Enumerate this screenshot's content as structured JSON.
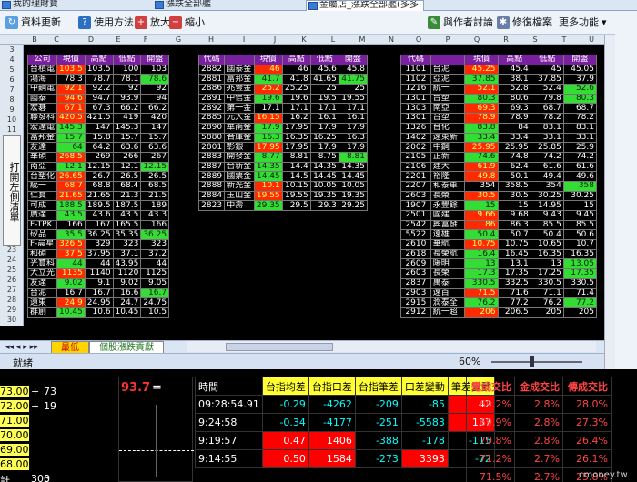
{
  "tabs": [
    "我的理財寶",
    "漲跌全部艦",
    "金屬店_漲跌全部艦(多多"
  ],
  "toolbar": {
    "update": "資料更新",
    "help": "使用方法",
    "zoom_in": "放大",
    "zoom_out": "縮小",
    "author": "與作者討論",
    "repair": "修復檔案",
    "more": "更多功能"
  },
  "col_letters": [
    "B",
    "C",
    "D",
    "E",
    "F",
    "G",
    "H",
    "I",
    "J",
    "K",
    "L",
    "M",
    "N",
    "O",
    "P",
    "Q",
    "R",
    "S",
    "T",
    "U"
  ],
  "row_nums": [
    "3",
    "4",
    "5",
    "6",
    "7",
    "8",
    "9",
    "10",
    "11",
    "12",
    "13",
    "14",
    "15",
    "16",
    "17",
    "18",
    "19",
    "20",
    "21",
    "22",
    "23",
    "24",
    "25",
    "26",
    "27",
    "28",
    "29",
    "30"
  ],
  "side_button": "打開左側清單",
  "headers": [
    "公司",
    "現價",
    "高點",
    "低點",
    "開盤"
  ],
  "headers2": [
    "代碼",
    "現價",
    "高點",
    "低點",
    "開盤"
  ],
  "table1": [
    [
      "台積電",
      "103.5",
      "103.5",
      "100",
      "103",
      "up",
      ""
    ],
    [
      "鴻海",
      "78.3",
      "78.7",
      "78.1",
      "78.6",
      "",
      "dn"
    ],
    [
      "中鋼電",
      "92.1",
      "92.2",
      "92",
      "92",
      "up",
      ""
    ],
    [
      "國泰",
      "94.6",
      "94.7",
      "93.9",
      "94",
      "up",
      ""
    ],
    [
      "宏碁",
      "67.1",
      "67.3",
      "66.2",
      "66.2",
      "up",
      ""
    ],
    [
      "聯發科",
      "420.5",
      "421.5",
      "419",
      "420",
      "up",
      ""
    ],
    [
      "宏達電",
      "145.3",
      "147",
      "145.3",
      "147",
      "dn",
      ""
    ],
    [
      "富邦金",
      "15.7",
      "15.8",
      "15.7",
      "15.7",
      "dn",
      ""
    ],
    [
      "友達",
      "64",
      "64.2",
      "63.6",
      "63.6",
      "dn",
      ""
    ],
    [
      "華碩",
      "268.5",
      "269",
      "266",
      "267",
      "up",
      ""
    ],
    [
      "南亞",
      "12.1",
      "12.15",
      "12.1",
      "12.15",
      "dn",
      "dn"
    ],
    [
      "台塑化",
      "26.65",
      "26.7",
      "26.5",
      "26.5",
      "up",
      ""
    ],
    [
      "統一",
      "68.7",
      "68.8",
      "68.4",
      "68.5",
      "up",
      ""
    ],
    [
      "仁寶",
      "21.65",
      "21.65",
      "21.3",
      "21.5",
      "up",
      ""
    ],
    [
      "可成",
      "188.5",
      "189.5",
      "187.5",
      "189",
      "dn",
      ""
    ],
    [
      "廣達",
      "43.5",
      "43.6",
      "43.5",
      "43.3",
      "dn",
      ""
    ],
    [
      "F-TPK",
      "166",
      "167",
      "165.5",
      "166",
      "",
      ""
    ],
    [
      "矽品",
      "35.5",
      "36.25",
      "35.35",
      "36.25",
      "dn",
      "dn"
    ],
    [
      "F-晨星",
      "326.5",
      "329",
      "323",
      "323",
      "up",
      ""
    ],
    [
      "和碩",
      "37.5",
      "37.95",
      "37.1",
      "37.2",
      "up",
      ""
    ],
    [
      "光寶科",
      "44",
      "44",
      "43.95",
      "44",
      "dn",
      ""
    ],
    [
      "大立光",
      "1135",
      "1140",
      "1120",
      "1125",
      "up",
      ""
    ],
    [
      "友達",
      "9.02",
      "9.1",
      "9.02",
      "9.05",
      "dn",
      ""
    ],
    [
      "台泥",
      "16.7",
      "16.7",
      "16.6",
      "16.7",
      "",
      "dn"
    ],
    [
      "遠東",
      "24.9",
      "24.95",
      "24.7",
      "24.75",
      "up",
      ""
    ],
    [
      "群創",
      "10.45",
      "10.6",
      "10.45",
      "10.5",
      "dn",
      ""
    ]
  ],
  "table2": [
    [
      "2882",
      "國泰金",
      "46",
      "46",
      "45.6",
      "45.8",
      "up",
      ""
    ],
    [
      "2881",
      "富邦金",
      "41.7",
      "41.8",
      "41.65",
      "41.75",
      "dn",
      "dn"
    ],
    [
      "2886",
      "兆豐金",
      "25.2",
      "25.25",
      "25",
      "25",
      "up",
      ""
    ],
    [
      "2891",
      "中信金",
      "19.6",
      "19.6",
      "19.5",
      "19.55",
      "dn",
      ""
    ],
    [
      "2892",
      "第一金",
      "17.1",
      "17.1",
      "17.1",
      "17.1",
      "",
      ""
    ],
    [
      "2885",
      "元大金",
      "16.15",
      "16.2",
      "16.1",
      "16.1",
      "up",
      ""
    ],
    [
      "2890",
      "華南金",
      "17.9",
      "17.95",
      "17.9",
      "17.9",
      "dn",
      ""
    ],
    [
      "5880",
      "合庫金",
      "16.3",
      "16.35",
      "16.25",
      "16.3",
      "dn",
      ""
    ],
    [
      "2801",
      "彰銀",
      "17.95",
      "17.95",
      "17.9",
      "17.9",
      "up",
      ""
    ],
    [
      "2883",
      "開發金",
      "8.77",
      "8.81",
      "8.75",
      "8.81",
      "dn",
      "dn"
    ],
    [
      "2887",
      "台新金",
      "14.35",
      "14.4",
      "14.35",
      "14.35",
      "dn",
      ""
    ],
    [
      "2889",
      "國票金",
      "14.45",
      "14.5",
      "14.45",
      "14.45",
      "dn",
      ""
    ],
    [
      "2888",
      "新光金",
      "10.1",
      "10.15",
      "10.05",
      "10.05",
      "up",
      ""
    ],
    [
      "2884",
      "玉山金",
      "19.55",
      "19.55",
      "19.35",
      "19.35",
      "up",
      ""
    ],
    [
      "2823",
      "中壽",
      "29.35",
      "29.5",
      "29.3",
      "29.25",
      "dn",
      ""
    ]
  ],
  "table3": [
    [
      "1101",
      "台泥",
      "45.25",
      "45.4",
      "45",
      "45.05",
      "up",
      ""
    ],
    [
      "1102",
      "亞泥",
      "37.85",
      "38.1",
      "37.85",
      "37.9",
      "dn",
      ""
    ],
    [
      "1216",
      "統一",
      "52.1",
      "52.8",
      "52.4",
      "52.6",
      "up",
      "dn"
    ],
    [
      "1301",
      "台塑",
      "80.3",
      "80.6",
      "79.8",
      "80.3",
      "dn",
      "dn"
    ],
    [
      "1303",
      "南亞",
      "69.3",
      "69.3",
      "68.7",
      "68.7",
      "up",
      ""
    ],
    [
      "1301",
      "台塑",
      "78.9",
      "78.9",
      "78.2",
      "78.2",
      "up",
      ""
    ],
    [
      "1326",
      "台化",
      "83.8",
      "84",
      "83.1",
      "83.1",
      "dn",
      ""
    ],
    [
      "1402",
      "遠東新",
      "33.4",
      "33.4",
      "33.1",
      "33.1",
      "dn",
      ""
    ],
    [
      "2002",
      "中鋼",
      "25.95",
      "25.95",
      "25.85",
      "25.9",
      "up",
      ""
    ],
    [
      "2105",
      "正新",
      "74.6",
      "74.8",
      "74.2",
      "74.2",
      "dn",
      ""
    ],
    [
      "2106",
      "建大",
      "61.9",
      "62.4",
      "61.6",
      "61.6",
      "up",
      ""
    ],
    [
      "2201",
      "裕隆",
      "49.8",
      "50.1",
      "49.4",
      "49.6",
      "up",
      ""
    ],
    [
      "2207",
      "和泰車",
      "354",
      "358.5",
      "354",
      "358",
      "",
      "dn"
    ],
    [
      "2603",
      "長榮",
      "30.5",
      "30.5",
      "30.25",
      "30.25",
      "up",
      ""
    ],
    [
      "1907",
      "永豐餘",
      "15",
      "15",
      "14.95",
      "15",
      "dn",
      ""
    ],
    [
      "2501",
      "國建",
      "9.66",
      "9.68",
      "9.43",
      "9.45",
      "up",
      ""
    ],
    [
      "2542",
      "興富發",
      "86",
      "86.3",
      "85.5",
      "85.5",
      "up",
      ""
    ],
    [
      "5522",
      "遠雄",
      "50.4",
      "50.7",
      "50.4",
      "50.6",
      "dn",
      ""
    ],
    [
      "2610",
      "華航",
      "10.75",
      "10.75",
      "10.65",
      "10.7",
      "up",
      ""
    ],
    [
      "2618",
      "長榮航",
      "16.4",
      "16.45",
      "16.35",
      "16.35",
      "dn",
      ""
    ],
    [
      "2609",
      "陽明",
      "13",
      "13.1",
      "13",
      "13.05",
      "dn",
      "dn"
    ],
    [
      "2603",
      "長榮",
      "17.3",
      "17.35",
      "17.25",
      "17.35",
      "dn",
      "dn"
    ],
    [
      "2837",
      "萬泰",
      "330.5",
      "332.5",
      "330.5",
      "330.5",
      "dn",
      ""
    ],
    [
      "2903",
      "遠百",
      "71.5",
      "71.6",
      "71.1",
      "71.4",
      "up",
      ""
    ],
    [
      "2915",
      "潤泰全",
      "76.2",
      "77.2",
      "76.2",
      "77.2",
      "dn",
      "dn"
    ],
    [
      "2912",
      "統一超",
      "206",
      "206.5",
      "205",
      "205",
      "up",
      ""
    ]
  ],
  "sheettab": [
    "最低",
    "個股漲跌貢獻"
  ],
  "status": {
    "ready": "就緒",
    "zoom": "60%"
  },
  "left_nums": [
    [
      "93.7",
      "="
    ]
  ],
  "left_rows": [
    [
      "73.00",
      "+",
      "73"
    ],
    [
      "72.00",
      "+",
      "19"
    ],
    [
      "71.00",
      ""
    ],
    [
      "70.00",
      ""
    ],
    [
      "69.00",
      ""
    ],
    [
      "68.00",
      ""
    ],
    [
      "計",
      "303",
      "0"
    ]
  ],
  "mid_header": [
    "時間",
    "台指均差",
    "台指口差",
    "台指筆差",
    "口差變動",
    "筆差變動"
  ],
  "mid_rows": [
    [
      "09:28:54.91",
      "-0.29",
      "-4262",
      "-209",
      "-85",
      "42"
    ],
    [
      "9:24:58",
      "-0.34",
      "-4177",
      "-251",
      "-5583",
      "137"
    ],
    [
      "9:19:57",
      "0.47",
      "1406",
      "-388",
      "-178",
      "-115"
    ],
    [
      "9:14:55",
      "0.50",
      "1584",
      "-273",
      "3393",
      "-72"
    ]
  ],
  "right_header": [
    "電成交比",
    "金成交比",
    "傳成交比"
  ],
  "right_rows": [
    [
      "69.2%",
      "2.8%",
      "28.0%"
    ],
    [
      "69.9%",
      "2.8%",
      "27.3%"
    ],
    [
      "70.8%",
      "2.8%",
      "26.4%"
    ],
    [
      "71.2%",
      "2.7%",
      "26.1%"
    ],
    [
      "71.5%",
      "2.7%",
      "25.8%"
    ]
  ],
  "watermark": "cmoney.tw"
}
